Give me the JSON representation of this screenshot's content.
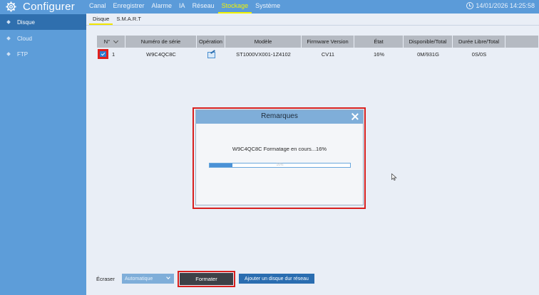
{
  "header": {
    "app_title": "Configurer",
    "nav": [
      "Canal",
      "Enregistrer",
      "Alarme",
      "IA",
      "Réseau",
      "Stockage",
      "Système"
    ],
    "active_nav": "Stockage",
    "datetime": "14/01/2026 14:25:58"
  },
  "sidebar": {
    "items": [
      {
        "label": "Disque",
        "active": true
      },
      {
        "label": "Cloud",
        "active": false
      },
      {
        "label": "FTP",
        "active": false
      }
    ]
  },
  "subtabs": {
    "items": [
      "Disque",
      "S.M.A.R.T"
    ],
    "active": "Disque"
  },
  "table": {
    "headers": [
      "N°",
      "Numéro de série",
      "Opération",
      "Modèle",
      "Firmware Version",
      "État",
      "Disponible/Total",
      "Durée Libre/Total"
    ],
    "rows": [
      {
        "num": "1",
        "serial": "W9C4QC8C",
        "model": "ST1000VX001-1Z4102",
        "firmware": "CV11",
        "state": "16%",
        "available": "0M/931G",
        "duration": "0S/0S",
        "checked": true
      }
    ]
  },
  "modal": {
    "title": "Remarques",
    "message": "W9C4QC8C Formatage en cours...16%",
    "progress_percent": 16,
    "progress_label": "16%"
  },
  "bottom": {
    "ecraser_label": "Écraser",
    "ecraser_value": "Automatique",
    "format_label": "Formater",
    "add_disk_label": "Ajouter un disque dur réseau"
  },
  "colors": {
    "topbar": "#5b9bd9",
    "sidebar_active": "#2f6fae",
    "highlight": "#d8201e",
    "active_tab": "#f2f200"
  }
}
